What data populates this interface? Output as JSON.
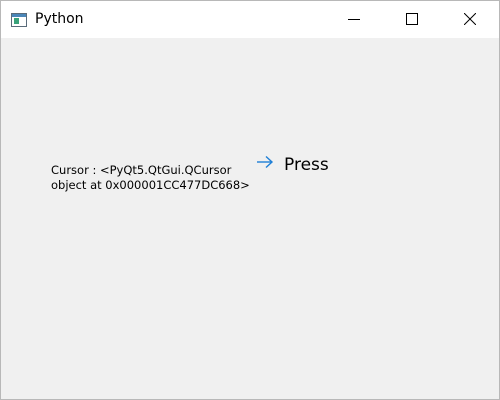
{
  "window": {
    "title": "Python",
    "controls": {
      "minimize": "minimize-icon",
      "maximize": "maximize-icon",
      "close": "close-icon"
    }
  },
  "content": {
    "cursor_label": "Cursor : <PyQt5.QtGui.QCursor object at 0x000001CC477DC668>",
    "press_button": {
      "label": "Press",
      "icon": "arrow-right-icon",
      "icon_color": "#1e7fd6"
    }
  },
  "colors": {
    "titlebar": "#ffffff",
    "client_bg": "#f0f0f0"
  }
}
